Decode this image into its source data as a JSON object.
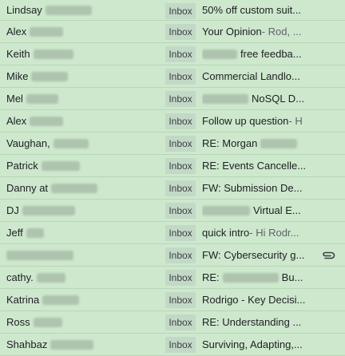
{
  "emails": [
    {
      "sender": "Lindsay",
      "redact_w": 58,
      "label": "Inbox",
      "subject": "50% off custom suit..."
    },
    {
      "sender": "Alex",
      "redact_w": 42,
      "label": "Inbox",
      "subject": "Your Opinion",
      "snippet": " - Rod, ..."
    },
    {
      "sender": "Keith",
      "redact_w": 50,
      "label": "Inbox",
      "subject_redact_w": 44,
      "subject": "free feedba..."
    },
    {
      "sender": "Mike",
      "redact_w": 46,
      "label": "Inbox",
      "subject": "Commercial Landlo..."
    },
    {
      "sender": "Mel",
      "redact_w": 40,
      "label": "Inbox",
      "subject_redact_w": 58,
      "subject": "NoSQL D..."
    },
    {
      "sender": "Alex",
      "redact_w": 42,
      "label": "Inbox",
      "subject": "Follow up question",
      "snippet": " - H"
    },
    {
      "sender": "Vaughan,",
      "redact_w": 44,
      "label": "Inbox",
      "subject": "RE: Morgan",
      "subject_redact_w_after": 46
    },
    {
      "sender": "Patrick",
      "redact_w": 48,
      "label": "Inbox",
      "subject": "RE: Events Cancelle..."
    },
    {
      "sender": "Danny at",
      "redact_w": 58,
      "label": "Inbox",
      "subject": "FW: Submission De..."
    },
    {
      "sender": "DJ",
      "redact_w": 66,
      "label": "Inbox",
      "subject_redact_w": 60,
      "subject": "Virtual E..."
    },
    {
      "sender": "Jeff",
      "redact_w": 22,
      "label": "Inbox",
      "subject": "quick intro",
      "snippet": " - Hi Rodr..."
    },
    {
      "sender": "",
      "redact_w": 84,
      "label": "Inbox",
      "subject": "FW: Cybersecurity g...",
      "attachment": "paperclip-icon"
    },
    {
      "sender": "cathy.",
      "redact_w": 36,
      "label": "Inbox",
      "subject": "RE:",
      "subject_redact_w_after": 70,
      "subject_tail": "Bu..."
    },
    {
      "sender": "Katrina",
      "redact_w": 46,
      "label": "Inbox",
      "subject": "Rodrigo - Key Decisi..."
    },
    {
      "sender": "Ross",
      "redact_w": 36,
      "label": "Inbox",
      "subject": "RE: Understanding ..."
    },
    {
      "sender": "Shahbaz",
      "redact_w": 54,
      "label": "Inbox",
      "subject": "Surviving, Adapting,..."
    }
  ],
  "colors": {
    "row_bg": "#cde8cd",
    "label_bg": "#c3d9c7",
    "divider": "#b8d6b8"
  }
}
